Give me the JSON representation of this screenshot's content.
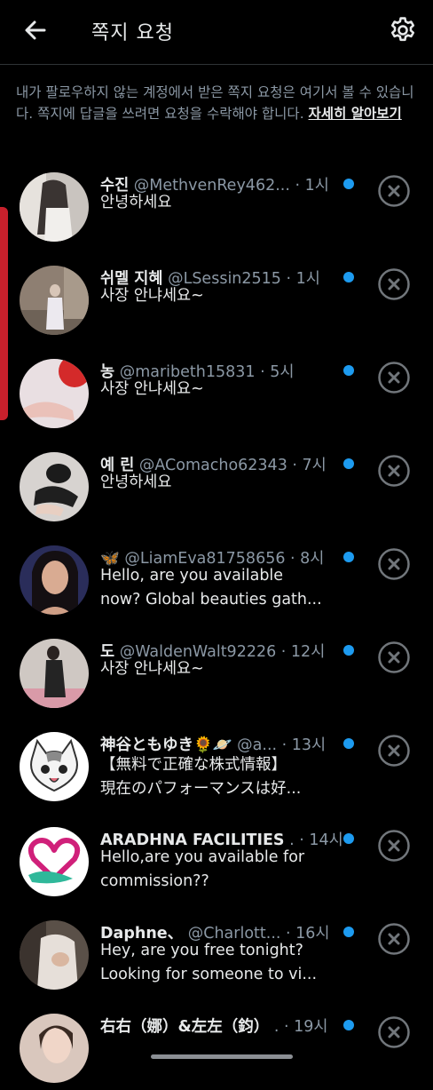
{
  "header": {
    "title": "쪽지 요청",
    "back_icon": "back-arrow-icon",
    "settings_icon": "gear-icon"
  },
  "notice": {
    "text": "내가 팔로우하지 않는 계정에서 받은 쪽지 요청은 여기서 볼 수 있습니다. 쪽지에 답글을 쓰려면 요청을 수락해야 합니다. ",
    "link": "자세히 알아보기"
  },
  "colors": {
    "unread_dot": "#1d9bf0",
    "muted": "#8b98a5",
    "background": "#000000"
  },
  "requests": [
    {
      "name": "수진",
      "handle": "@MethvenRey462...",
      "time": " · 1시",
      "line1": "안녕하세요",
      "line2": ""
    },
    {
      "name": "쉬멜 지혜",
      "handle": "@LSessin2515",
      "time": " · 1시",
      "line1": "사장 안냐세요~",
      "line2": ""
    },
    {
      "name": "농",
      "handle": "@maribeth15831",
      "time": " · 5시",
      "line1": "사장 안냐세요~",
      "line2": ""
    },
    {
      "name": "예 린",
      "handle": "@AComacho62343",
      "time": " · 7시",
      "line1": "안녕하세요",
      "line2": ""
    },
    {
      "name": "🦋",
      "handle": "@LiamEva81758656",
      "time": " · 8시",
      "line1": "Hello, are you available",
      "line2": "now? Global beauties gath..."
    },
    {
      "name": "도",
      "handle": "@WaldenWalt92226",
      "time": " · 12시",
      "line1": "사장 안냐세요~",
      "line2": ""
    },
    {
      "name": "神谷ともゆき🌻🪐",
      "handle": "@a...",
      "time": " · 13시",
      "line1": "【無料で正確な株式情報】",
      "line2": "現在のパフォーマンスは好..."
    },
    {
      "name": "ARADHNA FACILITIES",
      "handle": ".",
      "time": " · 14시",
      "line1": "Hello,are you available for",
      "line2": "commission??"
    },
    {
      "name": "Daphne、",
      "handle": "@Charlott...",
      "time": " · 16시",
      "line1": "Hey, are you free tonight?",
      "line2": "Looking for someone to vi..."
    },
    {
      "name": "右右（娜）&左左（鈞）",
      "handle": ".",
      "time": " · 19시",
      "line1": "",
      "line2": ""
    }
  ]
}
